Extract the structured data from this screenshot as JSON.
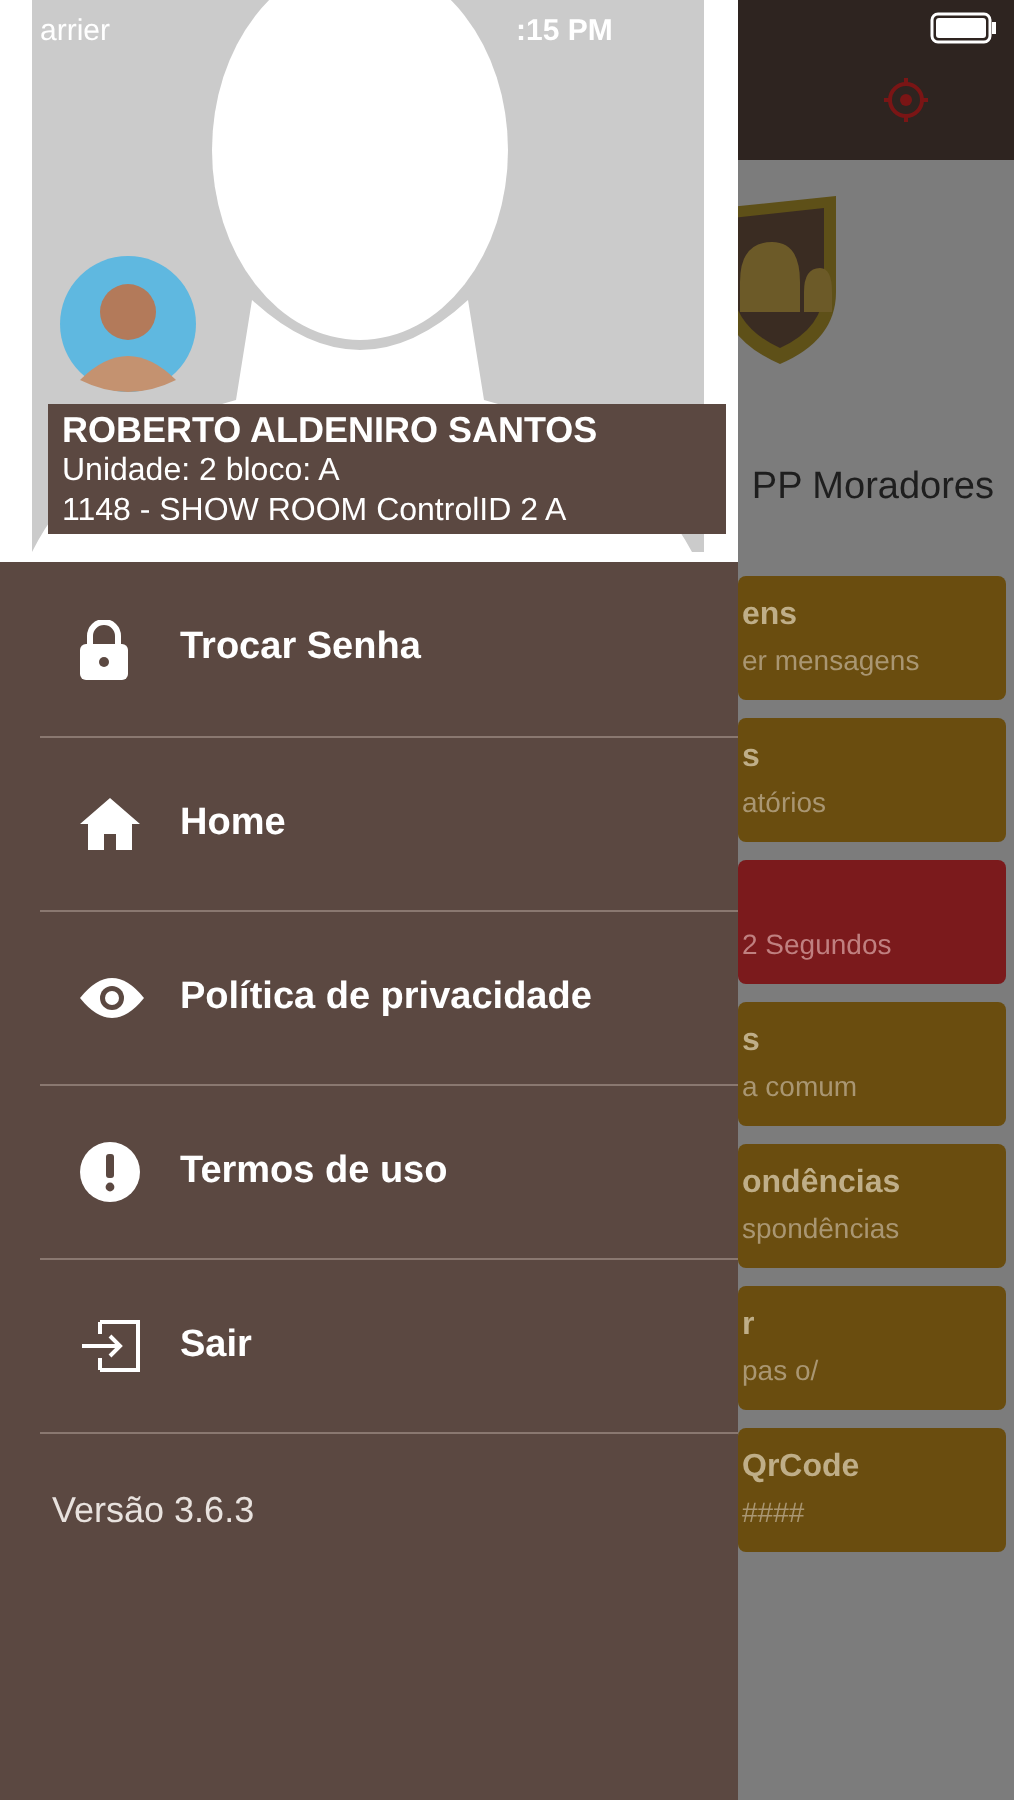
{
  "status_bar": {
    "carrier": "arrier",
    "time": ":15 PM"
  },
  "background_app": {
    "title": "PP Moradores",
    "cards": [
      {
        "title": "ens",
        "subtitle": "er mensagens",
        "color": "#6a4d0f"
      },
      {
        "title": "s",
        "subtitle": "atórios",
        "color": "#6a4d0f"
      },
      {
        "subtitle": "2 Segundos",
        "color": "#7b1a1c"
      },
      {
        "title": "s",
        "subtitle": "a comum",
        "color": "#6a4d0f"
      },
      {
        "title": "ondências",
        "subtitle": "spondências",
        "color": "#6a4d0f"
      },
      {
        "title": "r",
        "subtitle": "pas o/",
        "color": "#6a4d0f"
      },
      {
        "title": "QrCode",
        "subtitle": "####",
        "color": "#6a4d0f"
      }
    ]
  },
  "drawer": {
    "user": {
      "name": "ROBERTO ALDENIRO SANTOS",
      "unit": "Unidade: 2 bloco: A",
      "location": "1148 - SHOW ROOM ControlID 2 A"
    },
    "menu": [
      {
        "kind": "lock",
        "label": "Trocar Senha"
      },
      {
        "kind": "home",
        "label": "Home"
      },
      {
        "kind": "eye",
        "label": "Política de privacidade"
      },
      {
        "kind": "alert",
        "label": "Termos de uso"
      },
      {
        "kind": "exit",
        "label": "Sair"
      }
    ],
    "version": "Versão 3.6.3"
  }
}
